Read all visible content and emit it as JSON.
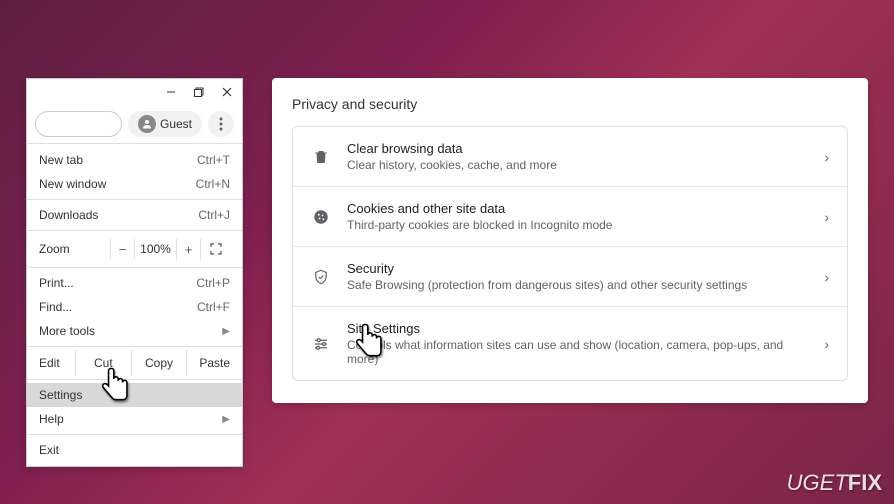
{
  "titlebar": {
    "minimize": "—",
    "maximize": "❐",
    "close": "✕"
  },
  "omnibar": {
    "guest_label": "Guest"
  },
  "menu": {
    "new_tab": "New tab",
    "new_tab_key": "Ctrl+T",
    "new_window": "New window",
    "new_window_key": "Ctrl+N",
    "downloads": "Downloads",
    "downloads_key": "Ctrl+J",
    "zoom_label": "Zoom",
    "zoom_minus": "−",
    "zoom_value": "100%",
    "zoom_plus": "+",
    "print": "Print...",
    "print_key": "Ctrl+P",
    "find": "Find...",
    "find_key": "Ctrl+F",
    "more_tools": "More tools",
    "edit_label": "Edit",
    "cut": "Cut",
    "copy": "Copy",
    "paste": "Paste",
    "settings": "Settings",
    "help": "Help",
    "exit": "Exit"
  },
  "panel": {
    "title": "Privacy and security",
    "items": [
      {
        "title": "Clear browsing data",
        "desc": "Clear history, cookies, cache, and more"
      },
      {
        "title": "Cookies and other site data",
        "desc": "Third-party cookies are blocked in Incognito mode"
      },
      {
        "title": "Security",
        "desc": "Safe Browsing (protection from dangerous sites) and other security settings"
      },
      {
        "title": "Site Settings",
        "desc": "Controls what information sites can use and show (location, camera, pop-ups, and more)"
      }
    ]
  },
  "watermark": {
    "light": "UGET",
    "bold": "FIX"
  }
}
